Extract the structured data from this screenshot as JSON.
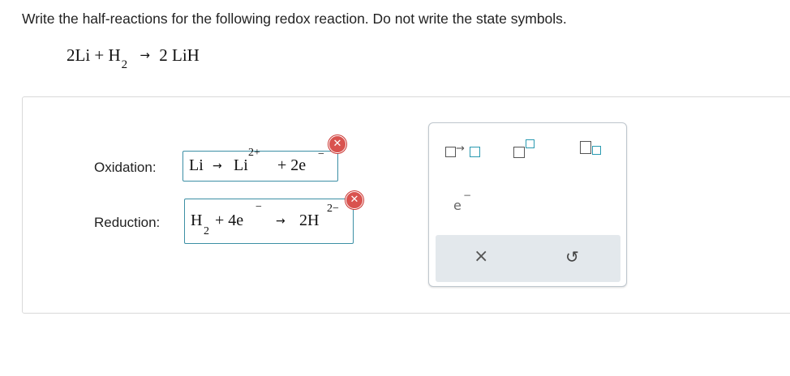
{
  "prompt": "Write the half-reactions for the following redox reaction. Do not write the state symbols.",
  "equation": {
    "left": "2Li + H",
    "left_sub": "2",
    "arrow": "→",
    "right": "2 LiH"
  },
  "oxidation": {
    "label": "Oxidation:",
    "reactant": "Li",
    "arrow": "→",
    "product": "Li",
    "product_charge": "2+",
    "plus_e": "+ 2e",
    "e_charge": "−"
  },
  "reduction": {
    "label": "Reduction:",
    "reactant": "H",
    "reactant_sub": "2",
    "plus_e": "+ 4e",
    "e_charge": "−",
    "arrow": "→",
    "product": "2H",
    "product_charge": "2−"
  },
  "palette": {
    "electron": "e",
    "electron_charge": "−",
    "clear": "×",
    "undo": "↺"
  },
  "colors": {
    "accent": "#3c8fa5",
    "error": "#d9534f",
    "footer": "#e3e8ec"
  }
}
